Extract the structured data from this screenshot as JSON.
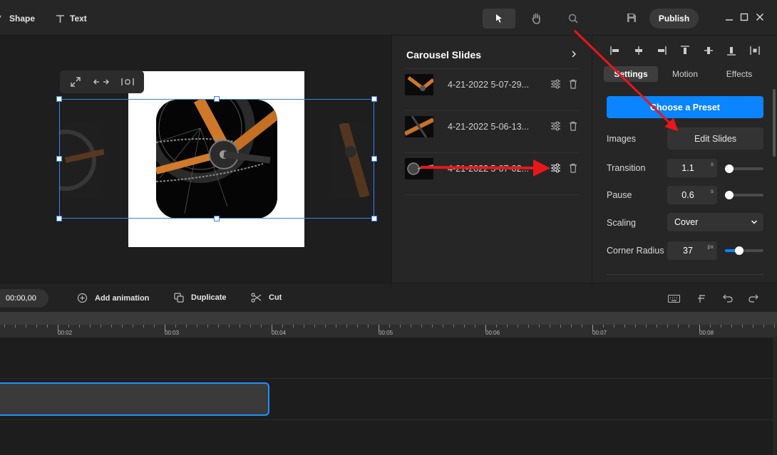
{
  "toolbar": {
    "shape_label": "Shape",
    "text_label": "Text",
    "publish_label": "Publish"
  },
  "carousel": {
    "title": "Carousel Slides",
    "slides": [
      {
        "name": "4-21-2022 5-07-29..."
      },
      {
        "name": "4-21-2022 5-06-13..."
      },
      {
        "name": "4-21-2022 5-07-02..."
      }
    ]
  },
  "properties": {
    "tabs": [
      "Settings",
      "Motion",
      "Effects"
    ],
    "active_tab": "Settings",
    "preset_label": "Choose a Preset",
    "images_label": "Images",
    "edit_slides_label": "Edit Slides",
    "transition": {
      "label": "Transition",
      "value": "1.1",
      "unit": "s",
      "level": 0.1
    },
    "pause": {
      "label": "Pause",
      "value": "0.6",
      "unit": "s",
      "level": 0.0
    },
    "scaling": {
      "label": "Scaling",
      "value": "Cover"
    },
    "corner_radius": {
      "label": "Corner Radius",
      "value": "37",
      "unit": "px",
      "level": 0.37
    }
  },
  "actions": {
    "timecode": "00:00,00",
    "add_animation": "Add animation",
    "duplicate": "Duplicate",
    "cut": "Cut"
  },
  "ruler": {
    "labels": [
      "00:02",
      "00:03",
      "00:04",
      "00:05",
      "00:06",
      "00:07",
      "00:08"
    ]
  },
  "colors": {
    "accent": "#0a84ff",
    "annotation_arrow": "#e8171b",
    "selection": "#3b82f6",
    "clip_border": "#1e90ff"
  },
  "icons": [
    "shape-icon",
    "text-icon",
    "pointer-icon",
    "hand-icon",
    "search-icon",
    "save-icon",
    "minimize-icon",
    "maximize-icon",
    "close-icon",
    "expand-icon",
    "stretch-icon",
    "fit-icon",
    "chevron-right-icon",
    "sliders-icon",
    "trash-icon",
    "plus-circle-icon",
    "duplicate-icon",
    "scissors-icon",
    "keyboard-icon",
    "snap-icon",
    "undo-icon",
    "redo-icon"
  ]
}
